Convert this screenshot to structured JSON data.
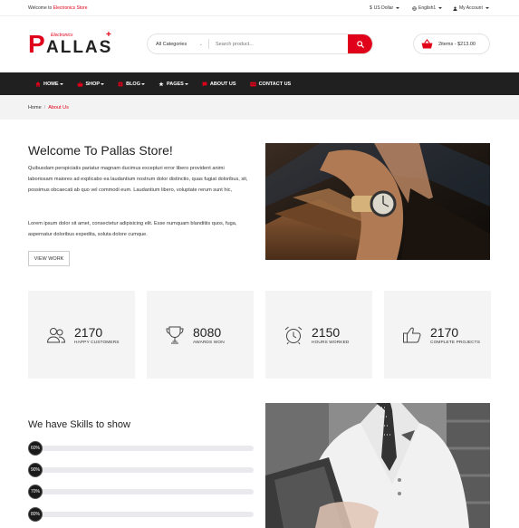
{
  "topbar": {
    "welcome_prefix": "Welcome to ",
    "welcome_brand": "Electronics Store",
    "currency": "US Dollar",
    "language": "English1",
    "account": "My Account"
  },
  "logo": {
    "letter": "P",
    "rest": "ALLAS",
    "subtitle": "Electronics"
  },
  "search": {
    "category": "All Categories",
    "placeholder": "Search product..."
  },
  "cart": {
    "summary": "2items - $213.00"
  },
  "nav": {
    "items": [
      {
        "label": "HOME",
        "icon": "home-icon",
        "dropdown": true
      },
      {
        "label": "SHOP",
        "icon": "shop-icon",
        "dropdown": true
      },
      {
        "label": "BLOG",
        "icon": "blog-icon",
        "dropdown": true
      },
      {
        "label": "PAGES",
        "icon": "star-icon",
        "dropdown": true
      },
      {
        "label": "ABOUT US",
        "icon": "chat-icon",
        "dropdown": false
      },
      {
        "label": "CONTACT US",
        "icon": "contact-icon",
        "dropdown": false
      }
    ]
  },
  "breadcrumb": {
    "home": "Home",
    "separator": "/",
    "current": "About Us"
  },
  "about": {
    "title": "Welcome To Pallas Store!",
    "para1": "Quibusdam perspiciatis pariatur magnam ducimus excepturi error libero provident animi laboriosam maiores ad explicabo ea laudantium nostrum dolor distinctio, quas fugiat doloribus, sit, possimus obcaecati ab quo vel commodi eum. Laudantium libero, voluptate rerum sunt hic,",
    "para2": "Lorem ipsum dolor sit amet, consectetur adipisicing elit. Esse numquam blanditiis quos, fuga, aspernatur doloribus expedita, soluta dolore cumque.",
    "button": "VIEW WORK"
  },
  "stats": [
    {
      "number": "2170",
      "label": "HAPPY CUSTOMERS",
      "icon": "users-icon"
    },
    {
      "number": "8080",
      "label": "AWARDS WON",
      "icon": "trophy-icon"
    },
    {
      "number": "2150",
      "label": "HOURS WORKED",
      "icon": "alarm-clock-icon"
    },
    {
      "number": "2170",
      "label": "COMPLETE PROJECTS",
      "icon": "thumbs-up-icon"
    }
  ],
  "skills": {
    "title": "We have Skills to show",
    "items": [
      {
        "percent": "60%"
      },
      {
        "percent": "90%"
      },
      {
        "percent": "70%"
      },
      {
        "percent": "80%"
      }
    ]
  },
  "colors": {
    "accent": "#e1001a",
    "nav_bg": "#202020"
  }
}
